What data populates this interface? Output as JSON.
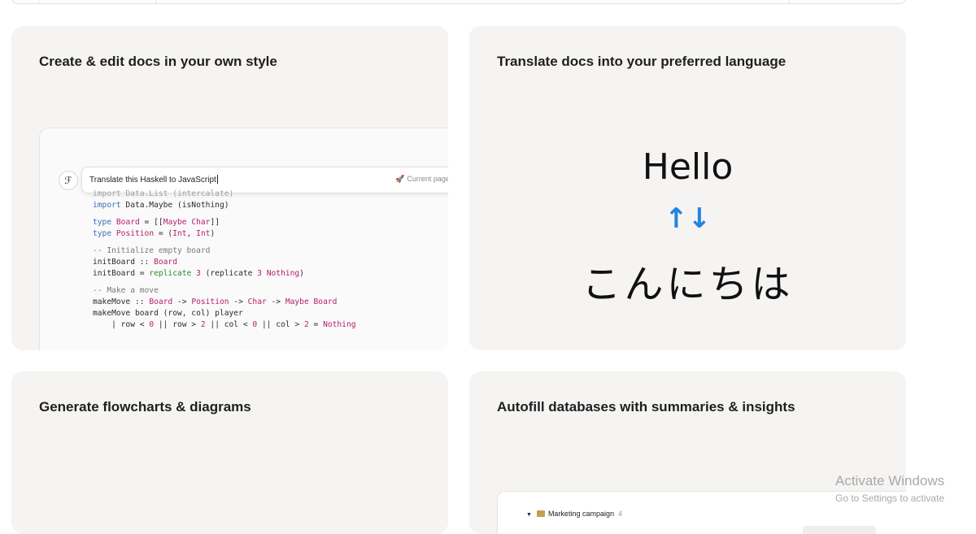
{
  "cards": [
    {
      "title": "Create & edit docs in your own style",
      "prompt": {
        "icon": "ai-pen-icon",
        "text": "Translate this Haskell to JavaScript",
        "scope_label": "Current page",
        "scope_icon": "rocket-icon"
      }
    },
    {
      "title": "Translate docs into your preferred language",
      "source_text": "Hello",
      "arrows": "↑↓",
      "target_text": "こんにちは"
    },
    {
      "title": "Generate flowcharts & diagrams"
    },
    {
      "title": "Autofill databases with summaries & insights",
      "database": {
        "group_name": "Marketing campaign",
        "group_count": "4",
        "group_icon": "folder-icon",
        "toggle_icon": "triangle-down-icon"
      }
    }
  ],
  "watermark": {
    "title": "Activate Windows",
    "subtitle": "Go to Settings to activate"
  },
  "colors": {
    "card_bg": "#f5f4f2",
    "accent_blue": "#2383e2",
    "code_keyword": "#3d6fb6",
    "code_type": "#b5206d",
    "code_function": "#2d8a34"
  }
}
